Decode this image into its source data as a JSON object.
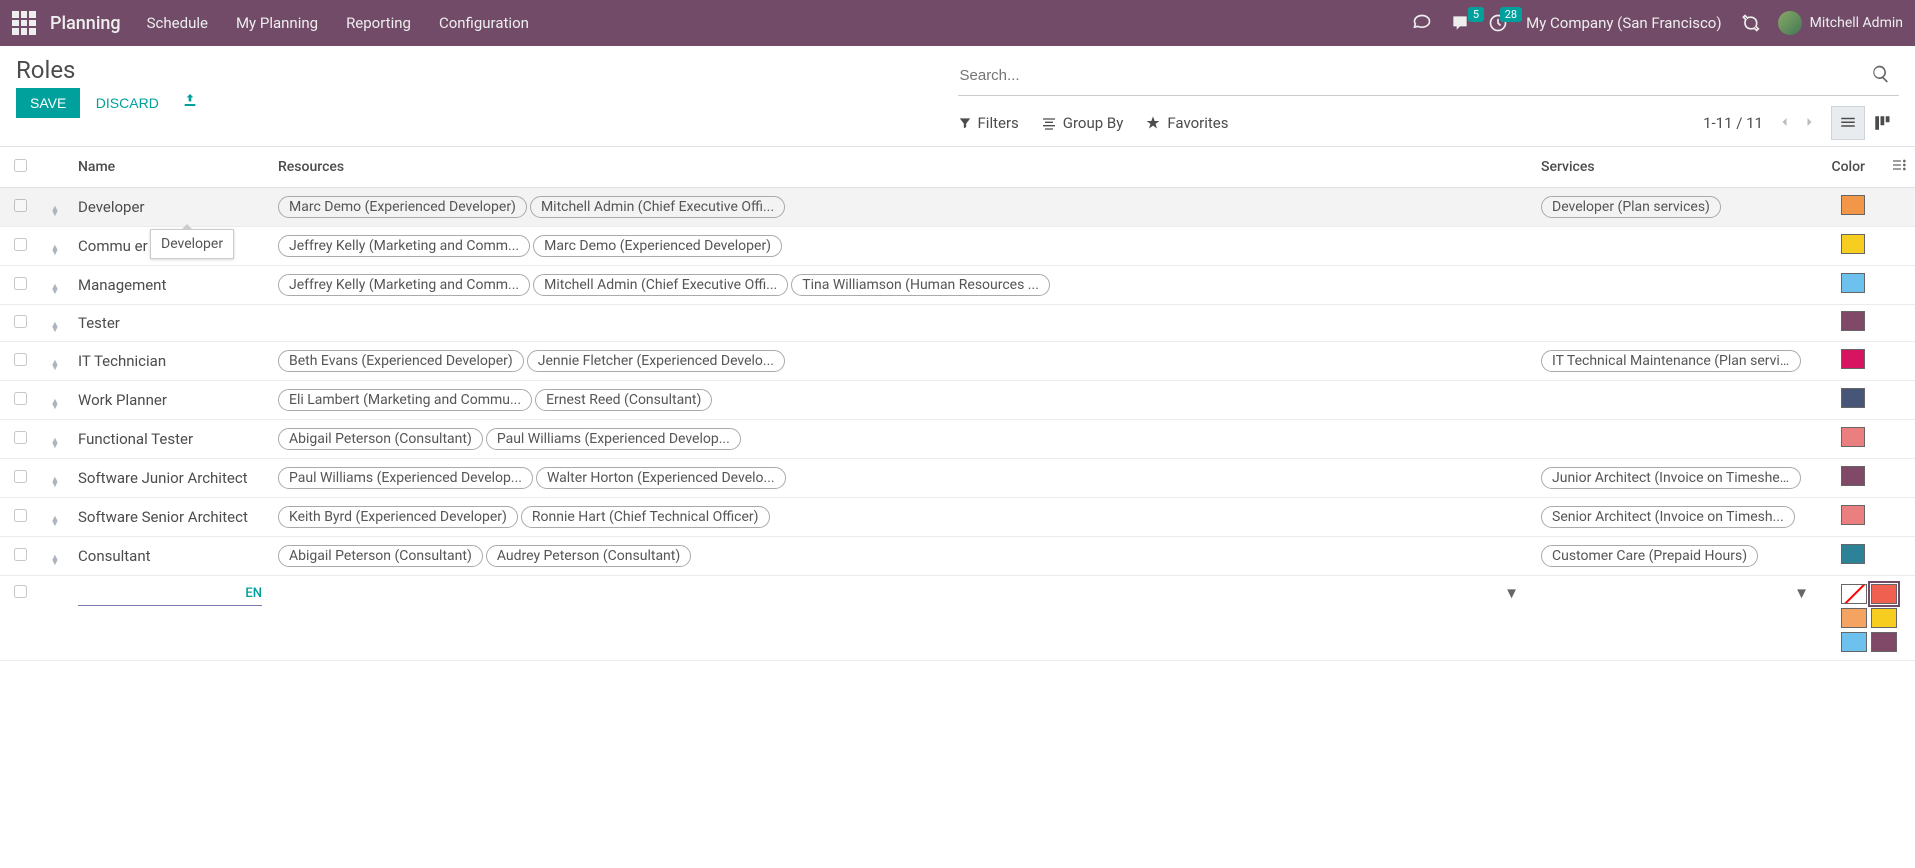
{
  "navbar": {
    "brand": "Planning",
    "links": [
      "Schedule",
      "My Planning",
      "Reporting",
      "Configuration"
    ],
    "messages_badge": "5",
    "activities_badge": "28",
    "company": "My Company (San Francisco)",
    "user": "Mitchell Admin"
  },
  "header": {
    "title": "Roles",
    "save": "SAVE",
    "discard": "DISCARD",
    "search_placeholder": "Search...",
    "filters": "Filters",
    "groupby": "Group By",
    "favorites": "Favorites",
    "pager": "1-11 / 11"
  },
  "lang_badge": "EN",
  "tooltip": "Developer",
  "columns": {
    "name": "Name",
    "resources": "Resources",
    "services": "Services",
    "color": "Color"
  },
  "rows": [
    {
      "name": "Developer",
      "resources": [
        "Marc Demo (Experienced Developer)",
        "Mitchell Admin (Chief Executive Offi..."
      ],
      "services": [
        "Developer (Plan services)"
      ],
      "color": "#F29648",
      "highlight": true
    },
    {
      "name": "Community Manager",
      "display_name": "Commu               er",
      "resources": [
        "Jeffrey Kelly (Marketing and Comm...",
        "Marc Demo (Experienced Developer)"
      ],
      "services": [],
      "color": "#F7CD1F"
    },
    {
      "name": "Management",
      "resources": [
        "Jeffrey Kelly (Marketing and Comm...",
        "Mitchell Admin (Chief Executive Offi...",
        "Tina Williamson (Human Resources ..."
      ],
      "services": [],
      "color": "#6CC1ED"
    },
    {
      "name": "Tester",
      "resources": [],
      "services": [],
      "color": "#814968"
    },
    {
      "name": "IT Technician",
      "resources": [
        "Beth Evans (Experienced Developer)",
        "Jennie Fletcher (Experienced Develo..."
      ],
      "services": [
        "IT Technical Maintenance (Plan servi..."
      ],
      "color": "#D6145F"
    },
    {
      "name": "Work Planner",
      "resources": [
        "Eli Lambert (Marketing and Commu...",
        "Ernest Reed (Consultant)"
      ],
      "services": [],
      "color": "#475577"
    },
    {
      "name": "Functional Tester",
      "resources": [
        "Abigail Peterson (Consultant)",
        "Paul Williams (Experienced Develop..."
      ],
      "services": [],
      "color": "#EB7E7F"
    },
    {
      "name": "Software Junior Architect",
      "resources": [
        "Paul Williams (Experienced Develop...",
        "Walter Horton (Experienced Develo..."
      ],
      "services": [
        "Junior Architect (Invoice on Timeshe..."
      ],
      "color": "#814968"
    },
    {
      "name": "Software Senior Architect",
      "resources": [
        "Keith Byrd (Experienced Developer)",
        "Ronnie Hart (Chief Technical Officer)"
      ],
      "services": [
        "Senior Architect (Invoice on Timesh..."
      ],
      "color": "#EB7E7F"
    },
    {
      "name": "Consultant",
      "resources": [
        "Abigail Peterson (Consultant)",
        "Audrey Peterson (Consultant)"
      ],
      "services": [
        "Customer Care (Prepaid Hours)"
      ],
      "color": "#2C8397"
    }
  ],
  "picker_colors": [
    "#F06050",
    "#F4A460",
    "#F7CD1F",
    "#6CC1ED",
    "#814968"
  ]
}
